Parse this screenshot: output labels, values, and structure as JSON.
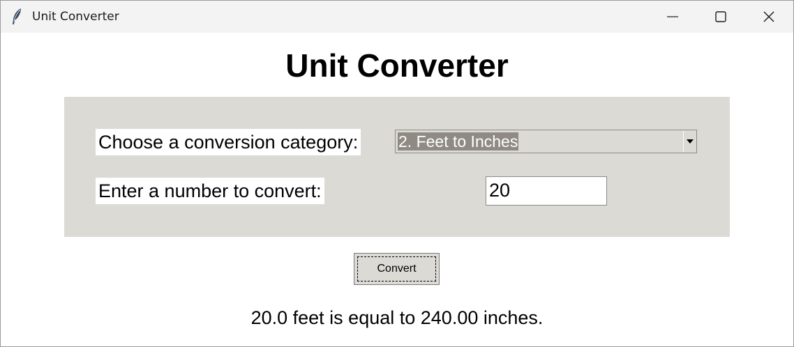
{
  "window": {
    "title": "Unit Converter",
    "icon": "feather-icon"
  },
  "app": {
    "heading": "Unit Converter"
  },
  "form": {
    "category_label": "Choose a conversion category:",
    "category_selected": "2. Feet to Inches",
    "number_label": "Enter a number to convert:",
    "number_value": "20"
  },
  "actions": {
    "convert_label": "Convert"
  },
  "result": {
    "text": "20.0 feet is equal to 240.00 inches."
  },
  "colors": {
    "panel_bg": "#dcdad5",
    "selection_bg": "#8f8b84",
    "titlebar_bg": "#f3f3f3"
  }
}
